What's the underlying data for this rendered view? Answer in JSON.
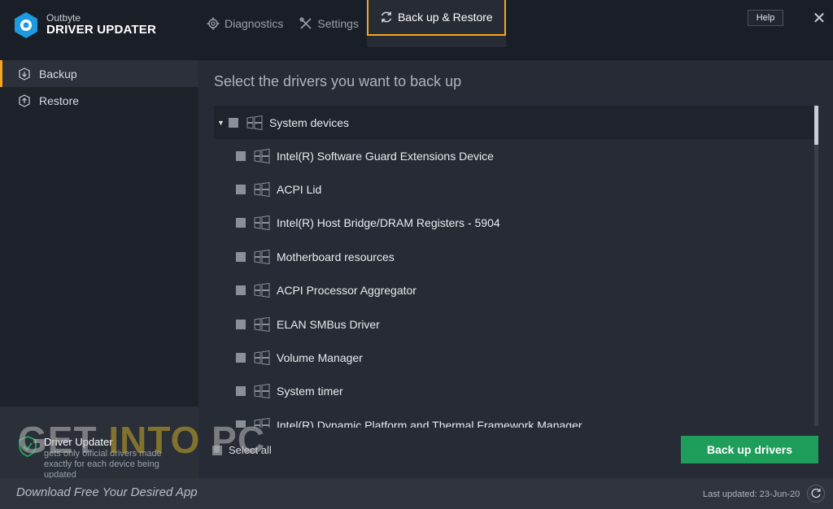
{
  "app": {
    "brand": "Outbyte",
    "product": "DRIVER UPDATER"
  },
  "tabs": [
    {
      "label": "Diagnostics",
      "icon": "gear-icon"
    },
    {
      "label": "Settings",
      "icon": "tools-icon"
    },
    {
      "label": "Back up & Restore",
      "icon": "sync-icon",
      "active": true
    }
  ],
  "window": {
    "help_label": "Help",
    "close_label": "✕"
  },
  "sidebar": {
    "items": [
      {
        "label": "Backup",
        "icon": "backup-icon",
        "active": true
      },
      {
        "label": "Restore",
        "icon": "restore-icon"
      }
    ],
    "footer": {
      "title": "Driver Updater",
      "description": "gets only official drivers made exactly for each device being updated"
    }
  },
  "main": {
    "title": "Select the drivers you want to back up",
    "group": "System devices",
    "items": [
      "Intel(R) Software Guard Extensions Device",
      "ACPI Lid",
      "Intel(R) Host Bridge/DRAM Registers - 5904",
      "Motherboard resources",
      "ACPI Processor Aggregator",
      "ELAN SMBus Driver",
      "Volume Manager",
      "System timer",
      "Intel(R) Dynamic Platform and Thermal Framework Manager"
    ],
    "select_all_label": "Select all",
    "backup_button_label": "Back up drivers"
  },
  "status": {
    "last_updated": "Last updated: 23-Jun-20"
  },
  "watermark": {
    "part1": "GET ",
    "part2": "INTO",
    "part3": " PC",
    "subtitle": "Download Free Your Desired App"
  },
  "colors": {
    "accent": "#f5a623",
    "primary_button": "#1e9e5a",
    "background": "#262b35"
  }
}
